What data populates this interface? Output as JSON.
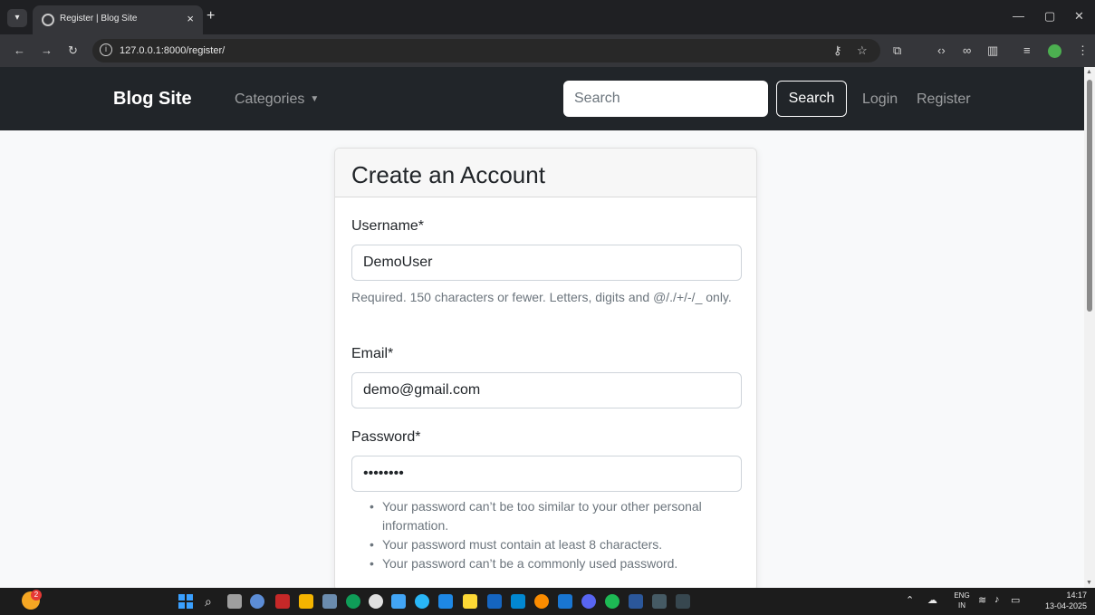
{
  "browser": {
    "tab_title": "Register | Blog Site",
    "url": "127.0.0.1:8000/register/"
  },
  "navbar": {
    "brand": "Blog Site",
    "categories": "Categories",
    "search_placeholder": "Search",
    "search_button": "Search",
    "login": "Login",
    "register": "Register"
  },
  "form": {
    "title": "Create an Account",
    "username_label": "Username*",
    "username_value": "DemoUser",
    "username_help": "Required. 150 characters or fewer. Letters, digits and @/./+/-/_ only.",
    "email_label": "Email*",
    "email_value": "demo@gmail.com",
    "password_label": "Password*",
    "password_value": "demopass",
    "password_rules": [
      "Your password can’t be too similar to your other personal information.",
      "Your password must contain at least 8 characters.",
      "Your password can’t be a commonly used password."
    ]
  },
  "taskbar": {
    "notification_count": "2",
    "language_top": "ENG",
    "language_bottom": "IN",
    "time": "14:17",
    "date": "13-04-2025"
  },
  "colors": {
    "navbar_bg": "#212529",
    "page_bg": "#f8f9fa",
    "card_header_bg": "#f7f7f7"
  }
}
